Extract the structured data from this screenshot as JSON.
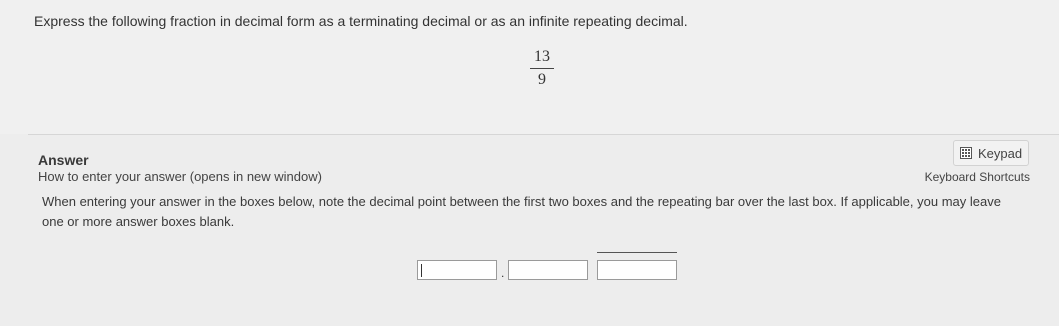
{
  "question": {
    "prompt": "Express the following fraction in decimal form as a terminating decimal or as an infinite repeating decimal.",
    "fraction": {
      "numerator": "13",
      "denominator": "9"
    }
  },
  "answer": {
    "label": "Answer",
    "howto_link": "How to enter your answer (opens in new window)",
    "keypad_button": "Keypad",
    "keypad_icon": "calculator-keypad-icon",
    "shortcuts_link": "Keyboard Shortcuts",
    "instructions": "When entering your answer in the boxes below, note the decimal point between the first two boxes and the repeating bar over the last box. If applicable, you may leave one or more answer boxes blank.",
    "boxes": {
      "whole": "",
      "non_repeating": "",
      "repeating": ""
    },
    "decimal_point": "."
  }
}
